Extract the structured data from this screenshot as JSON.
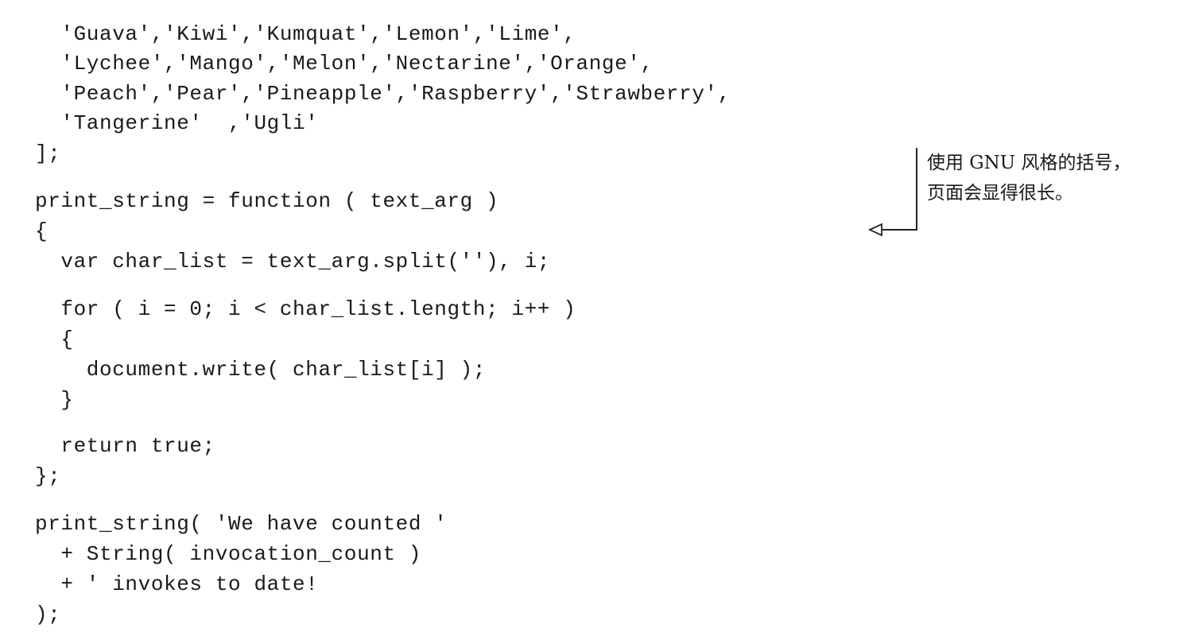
{
  "code": {
    "lines": [
      "  'Guava','Kiwi','Kumquat','Lemon','Lime',",
      "  'Lychee','Mango','Melon','Nectarine','Orange',",
      "  'Peach','Pear','Pineapple','Raspberry','Strawberry',",
      "  'Tangerine'  ,'Ugli'",
      "];",
      "print_string = function ( text_arg )",
      "{",
      "  var char_list = text_arg.split(''), i;",
      "  for ( i = 0; i < char_list.length; i++ )",
      "  {",
      "    document.write( char_list[i] );",
      "  }",
      "  return true;",
      "};",
      "print_string( 'We have counted '",
      "  + String( invocation_count )",
      "  + ' invokes to date!",
      ");"
    ]
  },
  "annotation": {
    "line1": "使用 GNU 风格的括号，",
    "line2": "页面会显得很长。"
  }
}
